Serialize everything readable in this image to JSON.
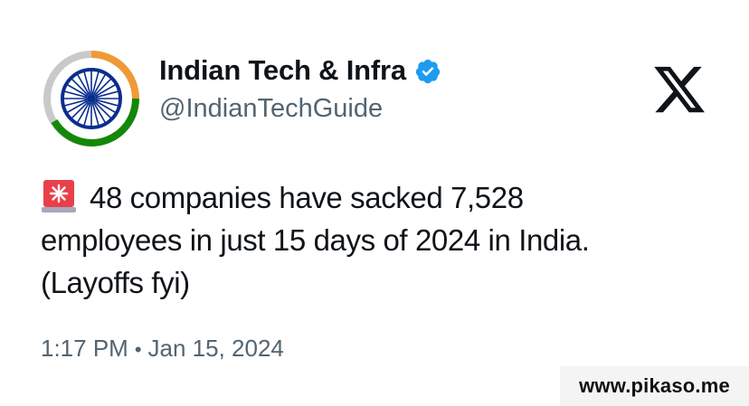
{
  "author": {
    "display_name": "Indian Tech & Infra",
    "handle": "@IndianTechGuide",
    "verified": true,
    "avatar_icon": "india-ashoka-chakra-avatar",
    "colors": {
      "saffron": "#f09a36",
      "green": "#138808",
      "navy": "#0b2d8f",
      "verified": "#1d9bf0"
    }
  },
  "platform_logo": "x-logo-icon",
  "tweet": {
    "emoji": "siren-icon",
    "line1": "48 companies have sacked 7,528",
    "line2": "employees in just 15 days of 2024 in India.",
    "line3": "(Layoffs fyi)"
  },
  "meta": {
    "time": "1:17 PM",
    "separator": "•",
    "date": "Jan 15, 2024"
  },
  "watermark": "www.pikaso.me"
}
